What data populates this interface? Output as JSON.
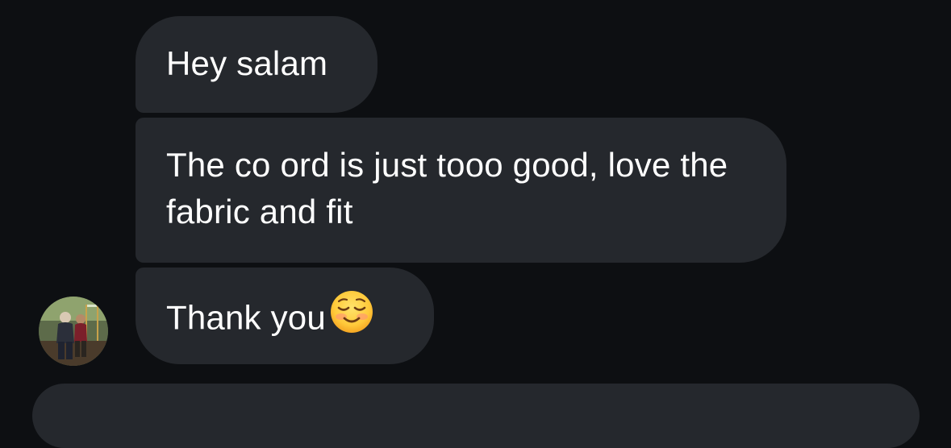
{
  "messages": [
    {
      "text": "Hey salam"
    },
    {
      "text": "The co ord is just tooo good, love the fabric and fit"
    },
    {
      "text": "Thank you",
      "emoji": "smiling-face-emoji"
    }
  ],
  "avatar": {
    "icon": "profile-photo"
  },
  "colors": {
    "background": "#0d0f12",
    "bubble": "#25282d",
    "text": "#ffffff"
  }
}
